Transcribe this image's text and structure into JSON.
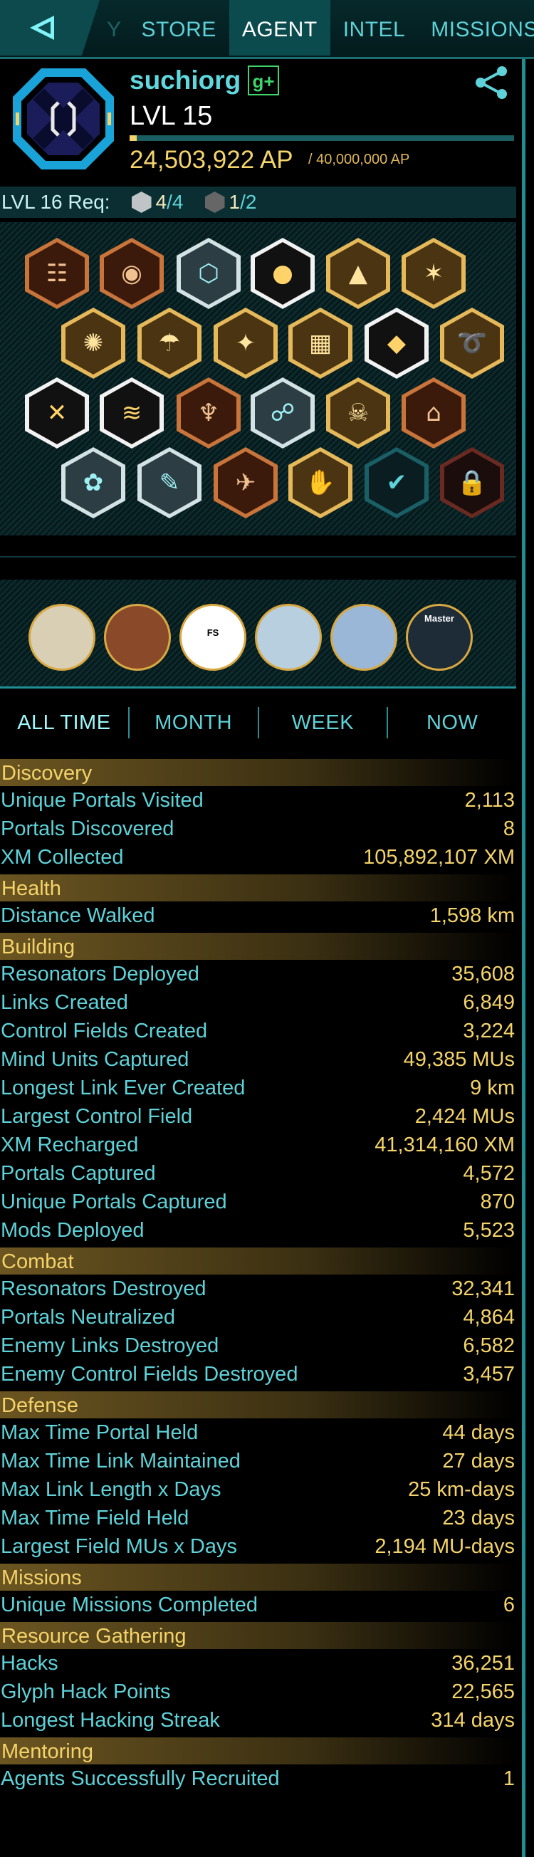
{
  "nav": {
    "back_icon": "back-arrow-icon",
    "tabs": [
      {
        "label": "Y",
        "state": "partial"
      },
      {
        "label": "STORE",
        "state": "normal"
      },
      {
        "label": "AGENT",
        "state": "active"
      },
      {
        "label": "INTEL",
        "state": "normal"
      },
      {
        "label": "MISSIONS",
        "state": "normal"
      }
    ]
  },
  "profile": {
    "agent_name": "suchiorg",
    "gplus_label": "g+",
    "level": "LVL 15",
    "ap": "24,503,922 AP",
    "ap_max": "/ 40,000,000 AP",
    "ap_progress": 0.0185,
    "faction_color": "#1aa3d8",
    "share_icon": "share-icon"
  },
  "requirements": {
    "label": "LVL 16 Req:",
    "silver_have": "4",
    "silver_need": "/4",
    "black_have": "1",
    "black_need": "/2"
  },
  "badges": [
    {
      "name": "badge-translator",
      "glyph": "☷",
      "tier": "bronze"
    },
    {
      "name": "badge-sojourner",
      "glyph": "◉",
      "tier": "bronze"
    },
    {
      "name": "badge-hacker",
      "glyph": "⬡",
      "tier": "platinum"
    },
    {
      "name": "badge-builder",
      "glyph": "●",
      "tier": "onyx"
    },
    {
      "name": "badge-connector",
      "glyph": "▲",
      "tier": "gold"
    },
    {
      "name": "badge-mind-controller",
      "glyph": "✶",
      "tier": "gold"
    },
    {
      "name": "badge-explorer",
      "glyph": "✺",
      "tier": "gold"
    },
    {
      "name": "badge-pioneer",
      "glyph": "☂",
      "tier": "gold"
    },
    {
      "name": "badge-engineer",
      "glyph": "✦",
      "tier": "gold"
    },
    {
      "name": "badge-illuminator",
      "glyph": "▦",
      "tier": "gold"
    },
    {
      "name": "badge-liberator",
      "glyph": "◆",
      "tier": "onyx"
    },
    {
      "name": "badge-recharger",
      "glyph": "➰",
      "tier": "gold"
    },
    {
      "name": "badge-purifier",
      "glyph": "✕",
      "tier": "onyx"
    },
    {
      "name": "badge-seer",
      "glyph": "≋",
      "tier": "onyx"
    },
    {
      "name": "badge-specops",
      "glyph": "♆",
      "tier": "bronze"
    },
    {
      "name": "badge-trekker",
      "glyph": "☍",
      "tier": "platinum"
    },
    {
      "name": "badge-guardian",
      "glyph": "☠",
      "tier": "gold"
    },
    {
      "name": "badge-recruiter",
      "glyph": "⌂",
      "tier": "bronze"
    },
    {
      "name": "badge-sojourn-b",
      "glyph": "✿",
      "tier": "platinum"
    },
    {
      "name": "badge-translator-b",
      "glyph": "✎",
      "tier": "platinum"
    },
    {
      "name": "badge-epoch",
      "glyph": "✈",
      "tier": "bronze"
    },
    {
      "name": "badge-mission-day",
      "glyph": "✋",
      "tier": "gold"
    },
    {
      "name": "badge-verified",
      "glyph": "✔",
      "tier": "black"
    },
    {
      "name": "badge-locked",
      "glyph": "🔒",
      "tier": "locked"
    }
  ],
  "missions": [
    {
      "label": ""
    },
    {
      "label": ""
    },
    {
      "label": "FS"
    },
    {
      "label": ""
    },
    {
      "label": ""
    },
    {
      "label": "Master"
    }
  ],
  "periods": [
    {
      "label": "ALL TIME",
      "active": true
    },
    {
      "label": "MONTH",
      "active": false
    },
    {
      "label": "WEEK",
      "active": false
    },
    {
      "label": "NOW",
      "active": false
    }
  ],
  "stats": [
    {
      "section": "Discovery",
      "rows": [
        [
          "Unique Portals Visited",
          "2,113"
        ],
        [
          "Portals Discovered",
          "8"
        ],
        [
          "XM Collected",
          "105,892,107 XM"
        ]
      ]
    },
    {
      "section": "Health",
      "rows": [
        [
          "Distance Walked",
          "1,598 km"
        ]
      ]
    },
    {
      "section": "Building",
      "rows": [
        [
          "Resonators Deployed",
          "35,608"
        ],
        [
          "Links Created",
          "6,849"
        ],
        [
          "Control Fields Created",
          "3,224"
        ],
        [
          "Mind Units Captured",
          "49,385 MUs"
        ],
        [
          "Longest Link Ever Created",
          "9 km"
        ],
        [
          "Largest Control Field",
          "2,424 MUs"
        ],
        [
          "XM Recharged",
          "41,314,160 XM"
        ],
        [
          "Portals Captured",
          "4,572"
        ],
        [
          "Unique Portals Captured",
          "870"
        ],
        [
          "Mods Deployed",
          "5,523"
        ]
      ]
    },
    {
      "section": "Combat",
      "rows": [
        [
          "Resonators Destroyed",
          "32,341"
        ],
        [
          "Portals Neutralized",
          "4,864"
        ],
        [
          "Enemy Links Destroyed",
          "6,582"
        ],
        [
          "Enemy Control Fields Destroyed",
          "3,457"
        ]
      ]
    },
    {
      "section": "Defense",
      "rows": [
        [
          "Max Time Portal Held",
          "44 days"
        ],
        [
          "Max Time Link Maintained",
          "27 days"
        ],
        [
          "Max Link Length x Days",
          "25 km-days"
        ],
        [
          "Max Time Field Held",
          "23 days"
        ],
        [
          "Largest Field MUs x Days",
          "2,194 MU-days"
        ]
      ]
    },
    {
      "section": "Missions",
      "rows": [
        [
          "Unique Missions Completed",
          "6"
        ]
      ]
    },
    {
      "section": "Resource Gathering",
      "rows": [
        [
          "Hacks",
          "36,251"
        ],
        [
          "Glyph Hack Points",
          "22,565"
        ],
        [
          "Longest Hacking Streak",
          "314 days"
        ]
      ]
    },
    {
      "section": "Mentoring",
      "rows": [
        [
          "Agents Successfully Recruited",
          "1"
        ]
      ]
    }
  ]
}
